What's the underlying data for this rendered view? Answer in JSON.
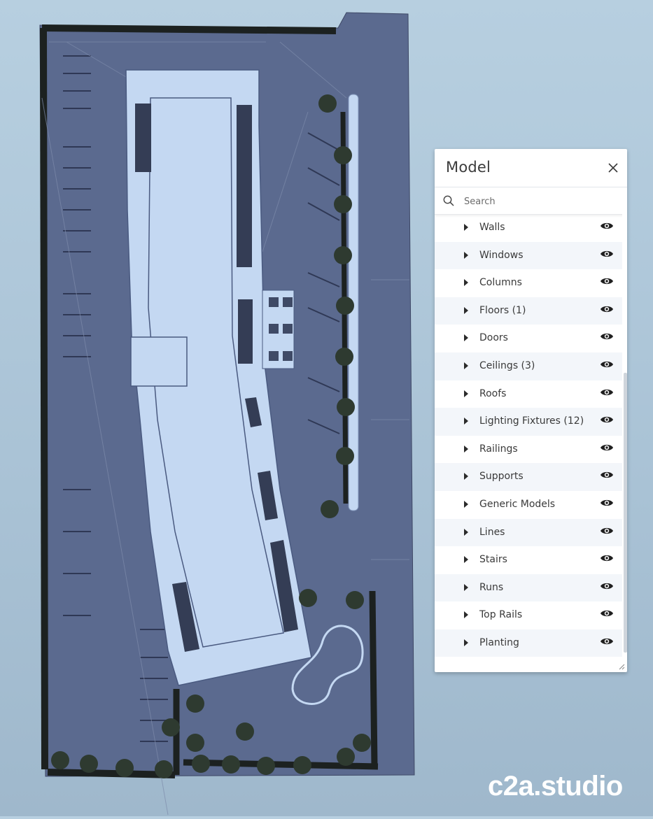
{
  "colors": {
    "background": "#b1c9dc",
    "site": "#5b6a8f",
    "building": "#c4d8f2",
    "hedge": "#1c2120",
    "panel": "#ffffff"
  },
  "viewer": {
    "logo": "c2a.studio"
  },
  "panel": {
    "title": "Model",
    "close_icon": "close-icon",
    "search": {
      "placeholder": "Search",
      "value": ""
    },
    "items": [
      {
        "label": "Walls",
        "visible": true
      },
      {
        "label": "Windows",
        "visible": true
      },
      {
        "label": "Columns",
        "visible": true
      },
      {
        "label": "Floors (1)",
        "visible": true
      },
      {
        "label": "Doors",
        "visible": true
      },
      {
        "label": "Ceilings (3)",
        "visible": true
      },
      {
        "label": "Roofs",
        "visible": true
      },
      {
        "label": "Lighting Fixtures (12)",
        "visible": true
      },
      {
        "label": "Railings",
        "visible": true
      },
      {
        "label": "Supports",
        "visible": true
      },
      {
        "label": "Generic Models",
        "visible": true
      },
      {
        "label": "Lines",
        "visible": true
      },
      {
        "label": "Stairs",
        "visible": true
      },
      {
        "label": "Runs",
        "visible": true
      },
      {
        "label": "Top Rails",
        "visible": true
      },
      {
        "label": "Planting",
        "visible": true
      }
    ]
  }
}
